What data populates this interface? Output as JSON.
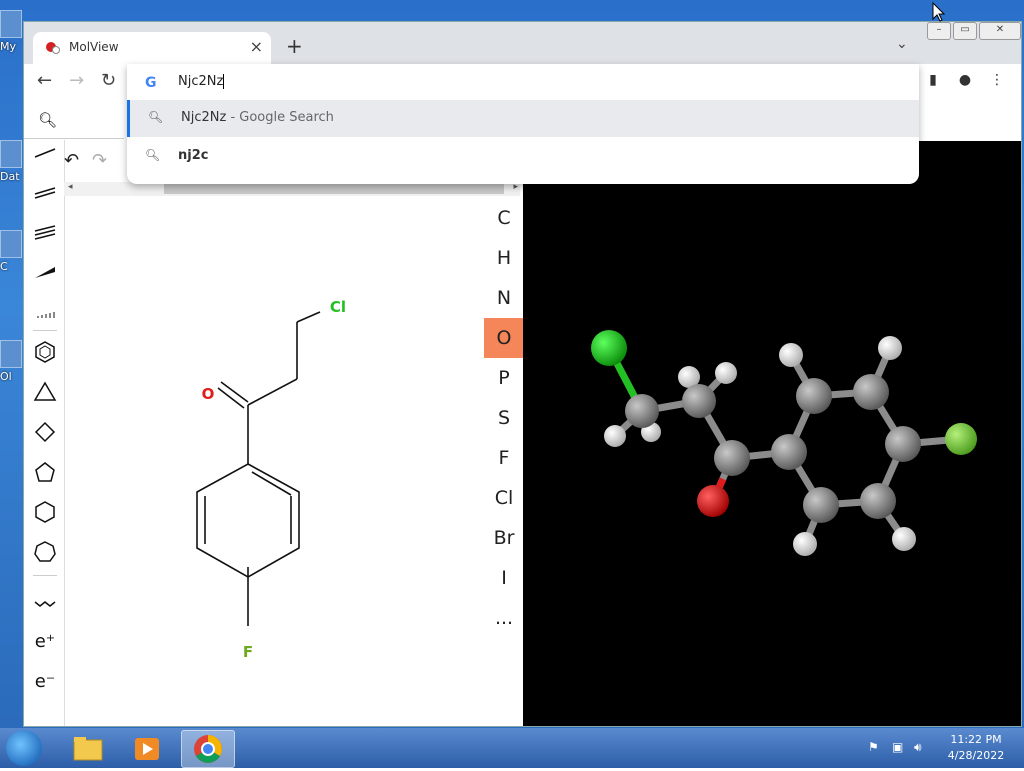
{
  "desktop": {
    "icons": [
      {
        "label": "My"
      },
      {
        "label": "Dat"
      },
      {
        "label": "C"
      },
      {
        "label": "Ol"
      }
    ]
  },
  "browser": {
    "tab_title": "MolView",
    "omnibox": {
      "value": "Njc2Nz",
      "suggestions": [
        {
          "text": "Njc2Nz",
          "suffix": " - Google Search"
        },
        {
          "text": "nj2c",
          "suffix": ""
        }
      ]
    }
  },
  "app": {
    "elements": [
      "C",
      "H",
      "N",
      "O",
      "P",
      "S",
      "F",
      "Cl",
      "Br",
      "I",
      "..."
    ],
    "active_element": "O",
    "molecule2d": {
      "labels": {
        "o": "O",
        "cl": "Cl",
        "f": "F"
      }
    },
    "tools": {
      "electron_plus": "e⁺",
      "electron_minus": "e⁻"
    }
  },
  "taskbar": {
    "time": "11:22 PM",
    "date": "4/28/2022"
  },
  "colors": {
    "active_element": "#f4865a",
    "chlorine": "#22c022",
    "oxygen": "#e01b1b",
    "fluorine": "#6ec836",
    "carbon": "#808080"
  }
}
